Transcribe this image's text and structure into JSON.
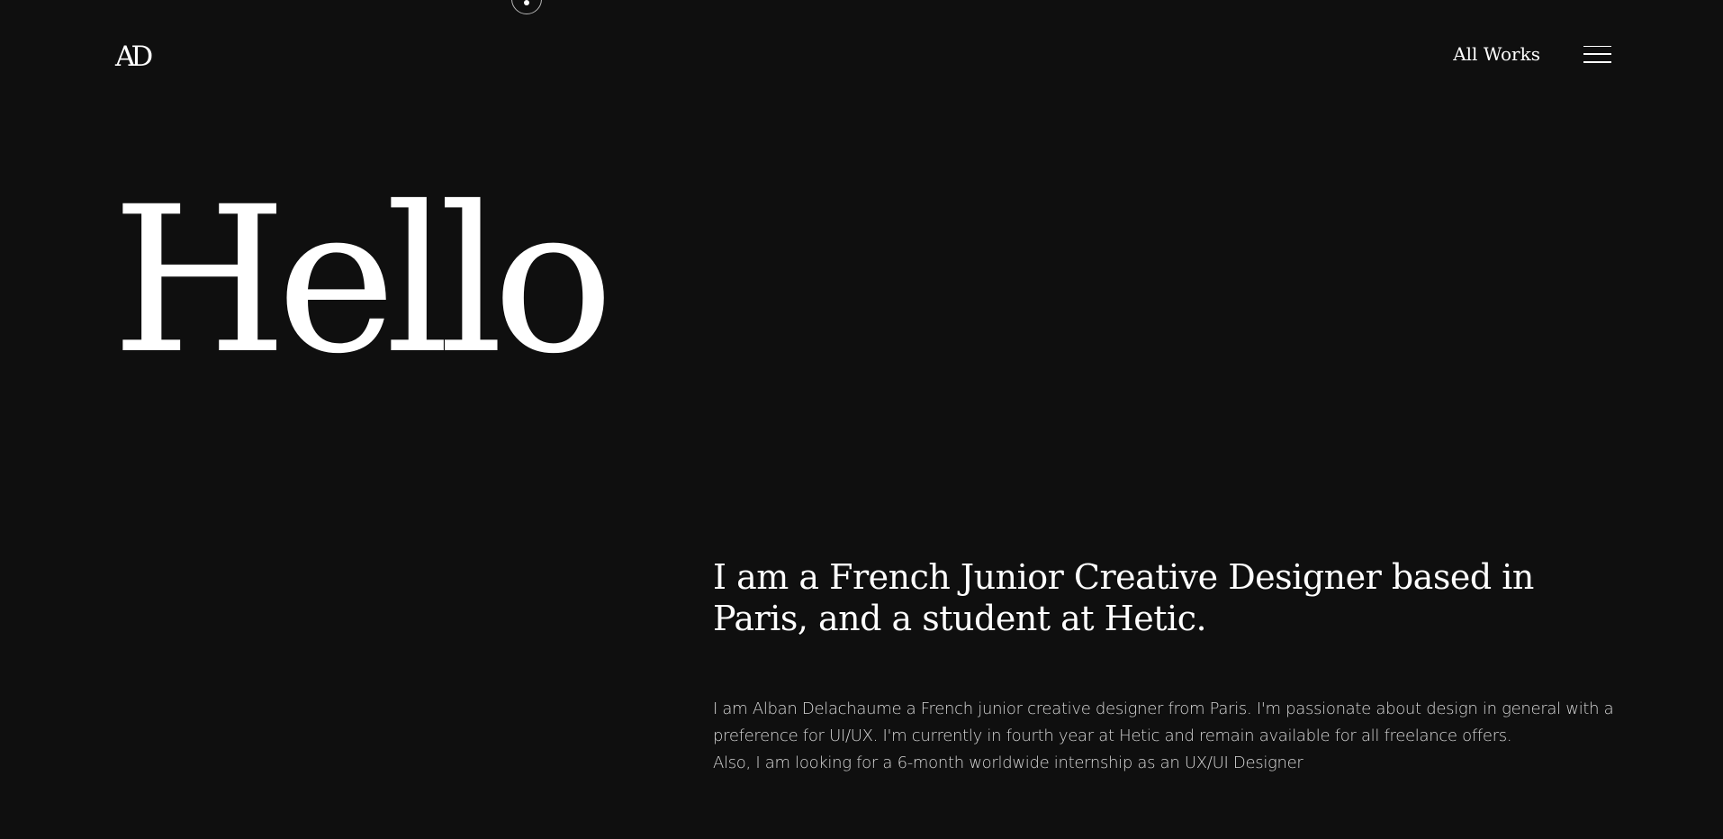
{
  "header": {
    "logo": "AD",
    "nav_link": "All Works",
    "menu_icon": "hamburger-menu-icon"
  },
  "hero": {
    "title": "Hello"
  },
  "about": {
    "headline": "I am a French Junior Creative Designer based in Paris, and a student at Hetic.",
    "bio_line_1": "I am Alban Delachaume a French junior creative designer from Paris. I'm passionate about design in general with a preference for UI/UX. I'm currently in fourth year at Hetic and remain available for all freelance offers.",
    "bio_line_2": "Also, I am looking for a 6-month worldwide internship as an UX/UI Designer"
  },
  "colors": {
    "background": "#0f0f0f",
    "text": "#ffffff",
    "muted_text": "#d6d6d6"
  }
}
